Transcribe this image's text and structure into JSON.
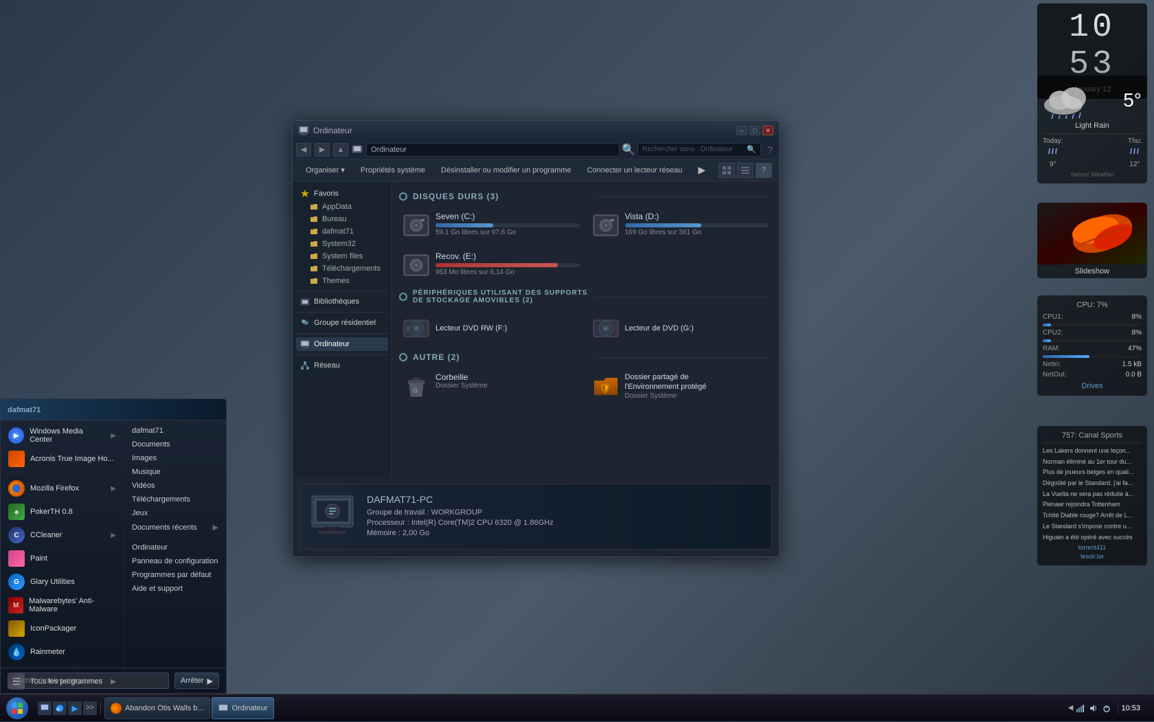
{
  "clock": {
    "hours": "10",
    "minutes": "53",
    "date": "January  12"
  },
  "weather": {
    "condition": "Light Rain",
    "temperature": "5",
    "unit": "°",
    "today_label": "Today:",
    "today_temp": "9°",
    "thu_label": "Thu:",
    "thu_temp": "12°",
    "source": "Yahoo! Weather"
  },
  "slideshow": {
    "label": "Slideshow"
  },
  "system": {
    "title": "CPU: 7%",
    "cpu1_label": "CPU1:",
    "cpu1_value": "8%",
    "cpu1_pct": 8,
    "cpu2_label": "CPU2:",
    "cpu2_value": "8%",
    "cpu2_pct": 8,
    "ram_label": "RAM:",
    "ram_value": "47%",
    "ram_pct": 47,
    "netin_label": "Netin:",
    "netin_value": "1.5 kB",
    "netout_label": "NetOut:",
    "netout_value": "0.0 B",
    "drives_link": "Drives"
  },
  "news": {
    "channel": "757: Canal Sports",
    "items": [
      "Les Lakers donnent une leçon...",
      "Norman éliminé au 1er tour du...",
      "Plus de joueurs belges en quali...",
      "Dégoûté par le Standard, j'ai fa...",
      "La Vuelta ne sera pas réduite à...",
      "Pienaar rejoindra Tottenham",
      "Tchité Diable rouge? Arrêt de L...",
      "Le Standard s'impose contre u...",
      "Higuain a été opéré avec succès"
    ],
    "source1": "torrent411",
    "source2": "lesoir.be"
  },
  "taskbar": {
    "time": "10:53",
    "items": [
      {
        "label": "Abandon Otis Walls b...",
        "icon": "firefox"
      },
      {
        "label": "Ordinateur",
        "icon": "explorer",
        "active": true
      }
    ]
  },
  "startmenu": {
    "visible": true,
    "left_items": [
      {
        "label": "Windows Media Center",
        "icon": "wmc",
        "arrow": true
      },
      {
        "label": "Acronis True Image Ho...",
        "icon": "acronis"
      },
      {
        "label": "Mozilla Firefox",
        "icon": "firefox",
        "arrow": true
      },
      {
        "label": "PokerTH 0.8",
        "icon": "poker"
      },
      {
        "label": "CCleaner",
        "icon": "ccleaner",
        "arrow": true
      },
      {
        "label": "Paint",
        "icon": "paint"
      },
      {
        "label": "Glary Utilities",
        "icon": "glary"
      },
      {
        "label": "Malwarebytes' Anti-Malware",
        "icon": "malware"
      },
      {
        "label": "IconPackager",
        "icon": "iconpack"
      },
      {
        "label": "Rainmeter",
        "icon": "rainmeter"
      },
      {
        "label": "Tous les programmes",
        "icon": "all",
        "arrow": true
      }
    ],
    "right_items": [
      {
        "label": "dafmat71"
      },
      {
        "label": "Documents"
      },
      {
        "label": "Images"
      },
      {
        "label": "Musique"
      },
      {
        "label": "Vidéos"
      },
      {
        "label": "Téléchargements"
      },
      {
        "label": "Jeux"
      },
      {
        "label": "Documents récents",
        "sub": true
      },
      {
        "label": "Ordinateur"
      },
      {
        "label": "Panneau de configuration"
      },
      {
        "label": "Programmes par défaut"
      },
      {
        "label": "Aide et support"
      }
    ],
    "search_placeholder": "Rechercher les prog...",
    "shutdown_label": "Arrêter"
  },
  "explorer": {
    "title": "Ordinateur",
    "search_placeholder": "Rechercher dans : Ordinateur",
    "toolbar": {
      "organiser": "Organiser ▾",
      "properties": "Propriétés système",
      "uninstall": "Désinstaller ou modifier un programme",
      "network": "Connecter un lecteur réseau"
    },
    "sidebar": {
      "items": [
        {
          "label": "Favoris",
          "type": "header"
        },
        {
          "label": "AppData"
        },
        {
          "label": "Bureau"
        },
        {
          "label": "dafmat71"
        },
        {
          "label": "System32"
        },
        {
          "label": "System files"
        },
        {
          "label": "Téléchargements"
        },
        {
          "label": "Themes"
        },
        {
          "label": "Bibliothèques",
          "type": "header"
        },
        {
          "label": "Groupe résidentiel",
          "type": "header"
        },
        {
          "label": "Ordinateur",
          "active": true
        }
      ]
    },
    "sections": {
      "hard_drives": {
        "title": "Disques durs (3)",
        "drives": [
          {
            "name": "Seven (C:)",
            "free": "59,1 Go libres sur 97,6 Go",
            "pct": 40
          },
          {
            "name": "Vista (D:)",
            "free": "169 Go libres sur 361 Go",
            "pct": 53
          },
          {
            "name": "Recov. (E:)",
            "free": "953 Mo libres sur 6,14 Go",
            "pct": 85,
            "low": true
          }
        ]
      },
      "removable": {
        "title": "Périphériques utilisant des supports de stockage amovibles (2)",
        "items": [
          {
            "name": "Lecteur DVD RW (F:)"
          },
          {
            "name": "Lecteur de DVD (G:)"
          }
        ]
      },
      "other": {
        "title": "Autre (2)",
        "items": [
          {
            "name": "Corbeille",
            "subtitle": "Dossier Système"
          },
          {
            "name": "Dossier partagé de l'Environnement protégé",
            "subtitle": "Dossier Système"
          }
        ]
      }
    },
    "computer_info": {
      "name": "DAFMAT71-PC",
      "workgroup_label": "Groupe de travail :",
      "workgroup": "WORKGROUP",
      "processor_label": "Processeur :",
      "processor": "Intel(R) Core(TM)2 CPU     6320 @ 1.86GHz",
      "memory_label": "Mémoire :",
      "memory": "2,00 Go"
    }
  }
}
